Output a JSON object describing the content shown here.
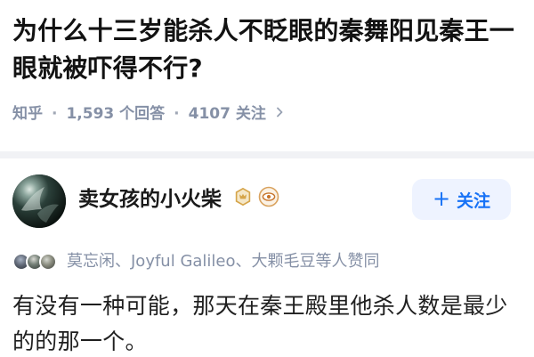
{
  "question": {
    "title": "为什么十三岁能杀人不眨眼的秦舞阳见秦王一眼就被吓得不行?"
  },
  "meta": {
    "source": "知乎",
    "answers_count": "1,593 个回答",
    "followers": "4107 关注"
  },
  "author": {
    "name": "卖女孩的小火柴",
    "follow_label": "关注"
  },
  "endorsement": {
    "text": "莫忘闲、Joyful Galileo、大颗毛豆等人赞同"
  },
  "answer": {
    "text": "有没有一种可能，那天在秦王殿里他杀人数是最少的的那一个。"
  },
  "icons": {
    "chevron": "chevron-right-icon",
    "plus": "plus-icon",
    "badge_primary": "creator-badge-icon",
    "badge_secondary": "eye-badge-icon"
  },
  "colors": {
    "accent": "#1772f6",
    "follow_bg": "#eef3ff",
    "muted": "#8590a6",
    "divider": "#f1f2f5",
    "badge_gold": "#d6a54a"
  }
}
